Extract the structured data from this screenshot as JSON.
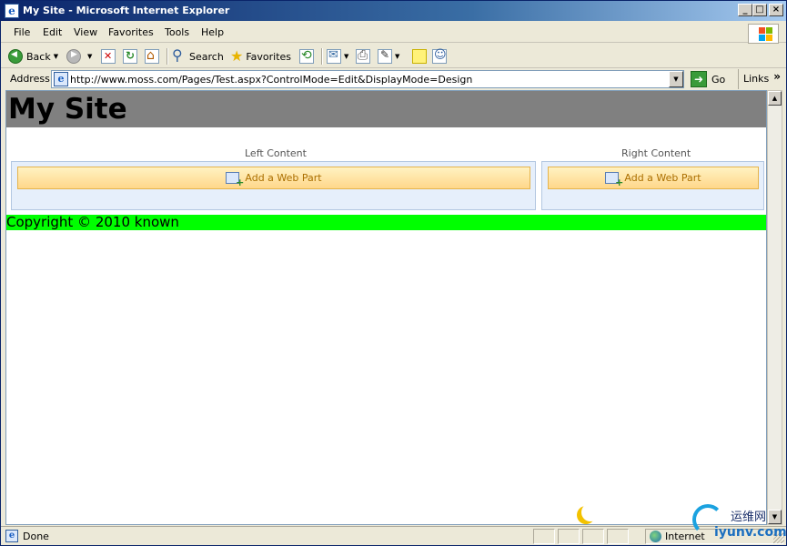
{
  "window": {
    "title": "My Site - Microsoft Internet Explorer",
    "controls": {
      "minimize": "_",
      "maximize": "□",
      "close": "×"
    }
  },
  "menu": {
    "items": [
      "File",
      "Edit",
      "View",
      "Favorites",
      "Tools",
      "Help"
    ]
  },
  "toolbar": {
    "back_label": "Back",
    "search_label": "Search",
    "favorites_label": "Favorites"
  },
  "address": {
    "label": "Address",
    "url": "http://www.moss.com/Pages/Test.aspx?ControlMode=Edit&DisplayMode=Design",
    "go_label": "Go",
    "links_label": "Links",
    "links_more": "»"
  },
  "page": {
    "site_title": "My Site",
    "left_zone": {
      "label": "Left Content",
      "add_label": "Add a Web Part"
    },
    "right_zone": {
      "label": "Right Content",
      "add_label": "Add a Web Part"
    },
    "footer": "Copyright © 2010 known"
  },
  "status": {
    "text": "Done",
    "zone": "Internet"
  },
  "watermark": {
    "brand": "运维网",
    "domain": "iyunv.com"
  },
  "colors": {
    "header_bg": "#808080",
    "footer_bg": "#00ff00",
    "add_button_text": "#ab6f00",
    "zone_bg": "#e6effb"
  }
}
